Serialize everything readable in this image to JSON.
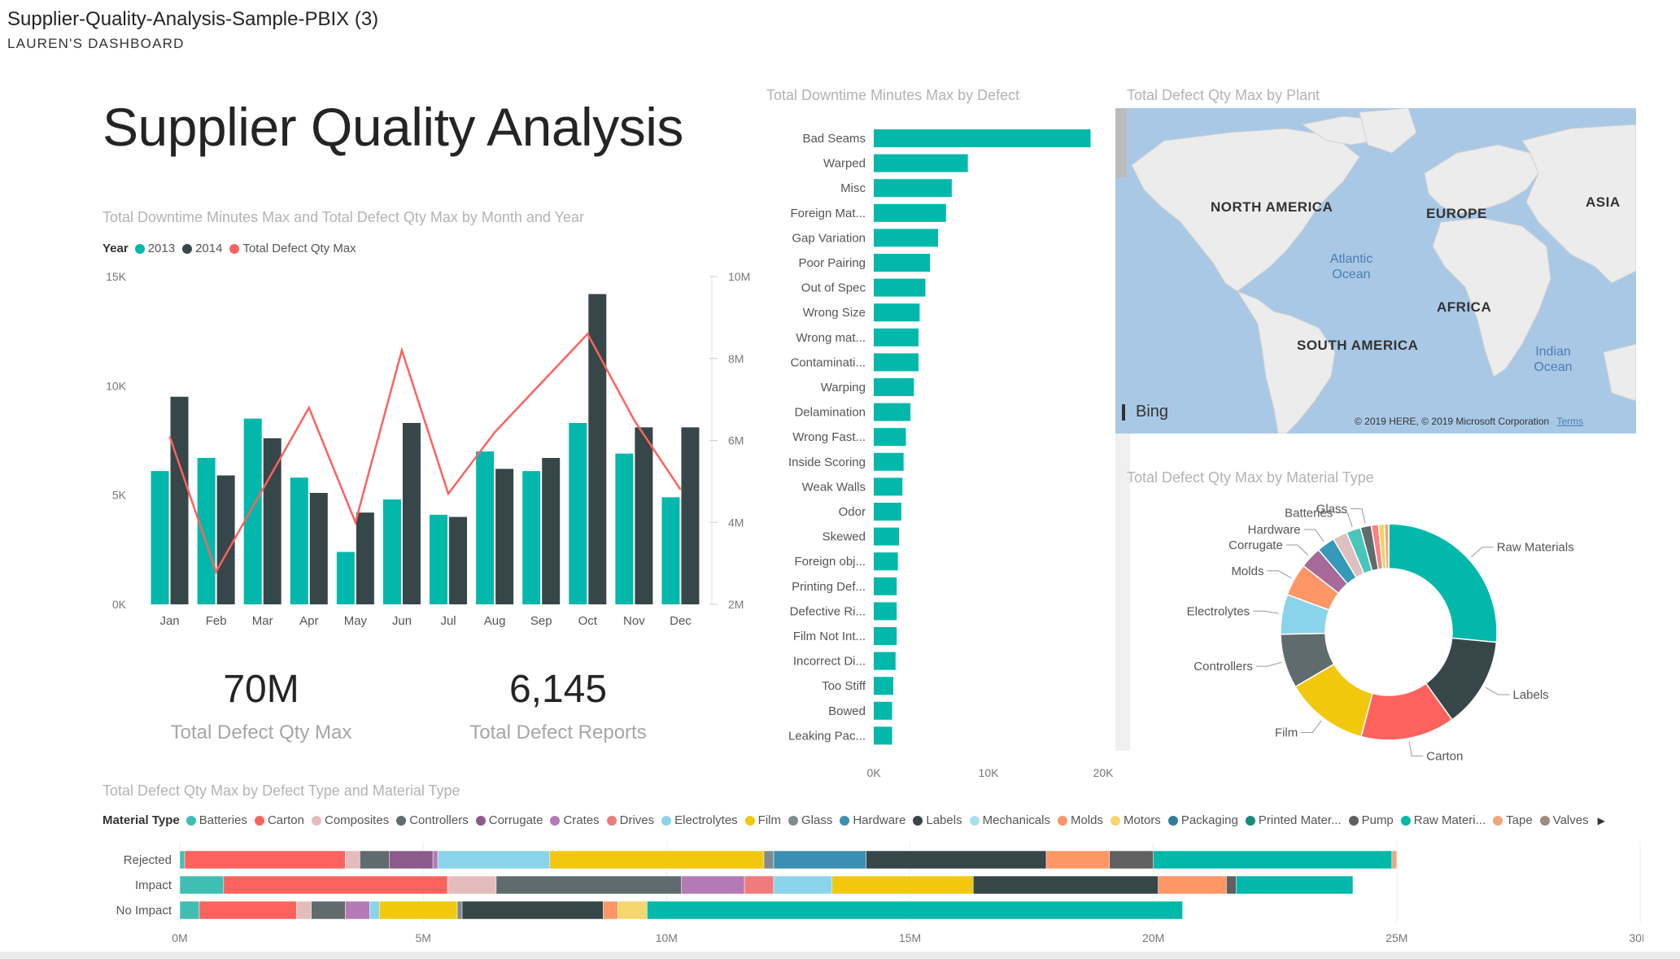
{
  "header": {
    "title": "Supplier-Quality-Analysis-Sample-PBIX (3)",
    "subtitle": "LAUREN'S DASHBOARD"
  },
  "page_title": "Supplier Quality Analysis",
  "colors": {
    "teal": "#01b8aa",
    "dark": "#374649",
    "red": "#fd625e",
    "grey_text": "#b3b3b3"
  },
  "combo_chart": {
    "title": "Total Downtime Minutes Max and Total Defect Qty Max by Month and Year",
    "legend_title": "Year",
    "legend": [
      {
        "label": "2013",
        "color": "#01b8aa"
      },
      {
        "label": "2014",
        "color": "#374649"
      },
      {
        "label": "Total Defect Qty Max",
        "color": "#fd625e"
      }
    ],
    "y_ticks": [
      "15K",
      "10K",
      "5K",
      "0K"
    ],
    "y2_ticks": [
      "10M",
      "8M",
      "6M",
      "4M",
      "2M"
    ]
  },
  "kpis": [
    {
      "value": "70M",
      "label": "Total Defect Qty Max"
    },
    {
      "value": "6,145",
      "label": "Total Defect Reports"
    }
  ],
  "defect_chart": {
    "title": "Total Downtime Minutes Max by Defect",
    "x_ticks": [
      "0K",
      "10K",
      "20K"
    ]
  },
  "map": {
    "title": "Total Defect Qty Max by Plant",
    "labels": [
      "NORTH AMERICA",
      "EUROPE",
      "ASIA",
      "AFRICA",
      "SOUTH AMERICA"
    ],
    "oceans": [
      "Atlantic Ocean",
      "Indian Ocean"
    ],
    "bing": "Bing",
    "copyright": "© 2019 HERE, © 2019 Microsoft Corporation",
    "terms": "Terms"
  },
  "donut": {
    "title": "Total Defect Qty Max by Material Type"
  },
  "stacked": {
    "title": "Total Defect Qty Max by Defect Type and Material Type",
    "legend_title": "Material Type",
    "legend": [
      {
        "label": "Batteries",
        "color": "#3fbfb3"
      },
      {
        "label": "Carton",
        "color": "#fd625e"
      },
      {
        "label": "Composites",
        "color": "#e5bcbc"
      },
      {
        "label": "Controllers",
        "color": "#5f6b6d"
      },
      {
        "label": "Corrugate",
        "color": "#8c5a8c"
      },
      {
        "label": "Crates",
        "color": "#b57ab5"
      },
      {
        "label": "Drives",
        "color": "#f07b7b"
      },
      {
        "label": "Electrolytes",
        "color": "#8ad4eb"
      },
      {
        "label": "Film",
        "color": "#f2c80f"
      },
      {
        "label": "Glass",
        "color": "#7f8c8d"
      },
      {
        "label": "Hardware",
        "color": "#3b8fb3"
      },
      {
        "label": "Labels",
        "color": "#374649"
      },
      {
        "label": "Mechanicals",
        "color": "#a6dfef"
      },
      {
        "label": "Molds",
        "color": "#fe9666"
      },
      {
        "label": "Motors",
        "color": "#f5d76e"
      },
      {
        "label": "Packaging",
        "color": "#2f7e9e"
      },
      {
        "label": "Printed Mater...",
        "color": "#1a8a7a"
      },
      {
        "label": "Pump",
        "color": "#606060"
      },
      {
        "label": "Raw Materi...",
        "color": "#01b8aa"
      },
      {
        "label": "Tape",
        "color": "#f2a47a"
      },
      {
        "label": "Valves",
        "color": "#a08a80"
      }
    ],
    "x_ticks": [
      "0M",
      "5M",
      "10M",
      "15M",
      "20M",
      "25M",
      "30M"
    ]
  },
  "chart_data": [
    {
      "type": "bar",
      "title": "Total Downtime Minutes Max and Total Defect Qty Max by Month and Year",
      "categories": [
        "Jan",
        "Feb",
        "Mar",
        "Apr",
        "May",
        "Jun",
        "Jul",
        "Aug",
        "Sep",
        "Oct",
        "Nov",
        "Dec"
      ],
      "series": [
        {
          "name": "2013",
          "values": [
            6100,
            6700,
            8500,
            5800,
            2400,
            4800,
            4100,
            7000,
            6100,
            8300,
            6900,
            4900
          ]
        },
        {
          "name": "2014",
          "values": [
            9500,
            5900,
            7600,
            5100,
            4200,
            8300,
            4000,
            6200,
            6700,
            14200,
            8100,
            8100
          ]
        },
        {
          "name": "Total Defect Qty Max",
          "values": [
            6100000,
            2800000,
            4800000,
            6800000,
            4000000,
            8200000,
            4700000,
            6200000,
            7400000,
            8600000,
            6500000,
            4800000
          ],
          "axis": "secondary"
        }
      ],
      "ylim": [
        0,
        15000
      ],
      "y2lim": [
        2000000,
        10000000
      ]
    },
    {
      "type": "bar",
      "orientation": "horizontal",
      "title": "Total Downtime Minutes Max by Defect",
      "categories": [
        "Bad Seams",
        "Warped",
        "Misc",
        "Foreign Mat...",
        "Gap Variation",
        "Poor Pairing",
        "Out of Spec",
        "Wrong Size",
        "Wrong mat...",
        "Contaminati...",
        "Warping",
        "Delamination",
        "Wrong Fast...",
        "Inside Scoring",
        "Weak Walls",
        "Odor",
        "Skewed",
        "Foreign obj...",
        "Printing Def...",
        "Defective Ri...",
        "Film Not Int...",
        "Incorrect Di...",
        "Too Stiff",
        "Bowed",
        "Leaking Pac..."
      ],
      "values": [
        18900,
        8200,
        6800,
        6300,
        5600,
        4900,
        4500,
        4000,
        3900,
        3900,
        3500,
        3200,
        2800,
        2600,
        2500,
        2400,
        2200,
        2100,
        2000,
        2000,
        2000,
        1900,
        1700,
        1600,
        1600
      ],
      "xlim": [
        0,
        20000
      ]
    },
    {
      "type": "pie",
      "title": "Total Defect Qty Max by Material Type",
      "hole": true,
      "categories": [
        "Raw Materials",
        "Labels",
        "Carton",
        "Film",
        "Controllers",
        "Electrolytes",
        "Molds",
        "Corrugate",
        "Hardware",
        "Composites",
        "Batteries",
        "Glass",
        "Drives",
        "Motors",
        "Tape"
      ],
      "values": [
        24.5,
        12.5,
        13,
        11.5,
        7.5,
        5.5,
        4.5,
        3,
        2.5,
        2,
        2,
        1.5,
        1,
        0.8,
        0.6
      ],
      "label_texts": [
        "Raw Materials",
        "Labels",
        "Carton",
        "Film",
        "Controllers",
        "Electrolytes",
        "Molds",
        "Corrugate",
        "Hardware",
        "Batteries",
        "Glass"
      ],
      "label_for_index": [
        0,
        1,
        2,
        3,
        4,
        5,
        6,
        7,
        8,
        10,
        11
      ],
      "colors": [
        "#01b8aa",
        "#374649",
        "#fd625e",
        "#f2c80f",
        "#5f6b6d",
        "#8ad4eb",
        "#fe9666",
        "#a66999",
        "#3599b8",
        "#dfbfbf",
        "#4ac5bb",
        "#5f6b6d",
        "#fb8281",
        "#f4d25a",
        "#f2a47a"
      ]
    },
    {
      "type": "bar",
      "orientation": "horizontal",
      "stacked": true,
      "title": "Total Defect Qty Max by Defect Type and Material Type",
      "categories": [
        "Rejected",
        "Impact",
        "No Impact"
      ],
      "series": [
        {
          "name": "Batteries",
          "values": [
            0.1,
            0.9,
            0.4
          ]
        },
        {
          "name": "Carton",
          "values": [
            3.3,
            4.6,
            2.0
          ]
        },
        {
          "name": "Composites",
          "values": [
            0.3,
            1.0,
            0.3
          ]
        },
        {
          "name": "Controllers",
          "values": [
            0.6,
            3.8,
            0.7
          ]
        },
        {
          "name": "Corrugate",
          "values": [
            0.9,
            0.0,
            0.0
          ]
        },
        {
          "name": "Crates",
          "values": [
            0.1,
            1.3,
            0.5
          ]
        },
        {
          "name": "Drives",
          "values": [
            0.0,
            0.6,
            0.0
          ]
        },
        {
          "name": "Electrolytes",
          "values": [
            2.3,
            1.2,
            0.2
          ]
        },
        {
          "name": "Film",
          "values": [
            4.4,
            2.9,
            1.6
          ]
        },
        {
          "name": "Glass",
          "values": [
            0.2,
            0.0,
            0.1
          ]
        },
        {
          "name": "Hardware",
          "values": [
            1.9,
            0.0,
            0.0
          ]
        },
        {
          "name": "Labels",
          "values": [
            3.7,
            3.8,
            2.9
          ]
        },
        {
          "name": "Mechanicals",
          "values": [
            0.0,
            0.0,
            0.0
          ]
        },
        {
          "name": "Molds",
          "values": [
            1.3,
            1.4,
            0.3
          ]
        },
        {
          "name": "Motors",
          "values": [
            0.0,
            0.0,
            0.6
          ]
        },
        {
          "name": "Packaging",
          "values": [
            0.0,
            0.0,
            0.0
          ]
        },
        {
          "name": "Printed Mater...",
          "values": [
            0.0,
            0.0,
            0.0
          ]
        },
        {
          "name": "Pump",
          "values": [
            0.9,
            0.2,
            0.0
          ]
        },
        {
          "name": "Raw Materi...",
          "values": [
            4.9,
            2.4,
            11.0
          ]
        },
        {
          "name": "Tape",
          "values": [
            0.1,
            0.0,
            0.0
          ]
        },
        {
          "name": "Valves",
          "values": [
            0.0,
            0.0,
            0.0
          ]
        }
      ],
      "xlim": [
        0,
        30000000
      ]
    }
  ]
}
